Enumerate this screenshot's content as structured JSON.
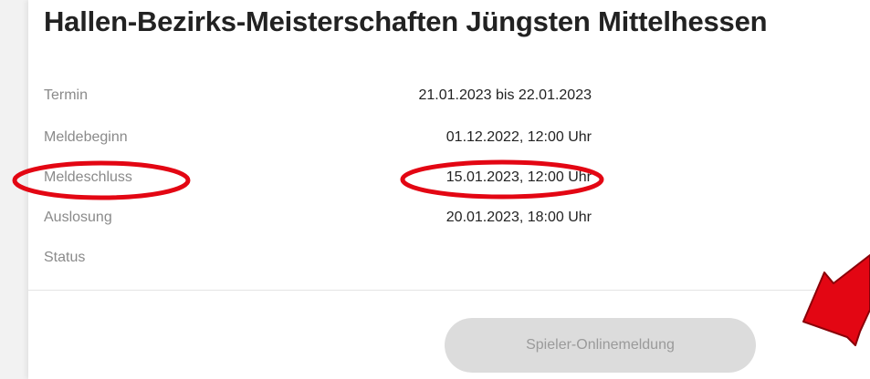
{
  "page": {
    "title": "Hallen-Bezirks-Meisterschaften Jüngsten Mittelhessen"
  },
  "details": [
    {
      "label": "Termin",
      "value": "21.01.2023 bis 22.01.2023"
    },
    {
      "label": "Meldebeginn",
      "value": "01.12.2022, 12:00 Uhr"
    },
    {
      "label": "Meldeschluss",
      "value": "15.01.2023, 12:00 Uhr"
    },
    {
      "label": "Auslosung",
      "value": "20.01.2023, 18:00 Uhr"
    },
    {
      "label": "Status",
      "value": ""
    }
  ],
  "actions": {
    "register_label": "Spieler-Onlinemeldung"
  },
  "colors": {
    "annotation": "#e30613",
    "button_bg": "#dcdcdc",
    "label": "#8a8a8a"
  },
  "annotations": {
    "highlight_shape": "ellipse",
    "pointer_icon": "arrow-icon"
  }
}
